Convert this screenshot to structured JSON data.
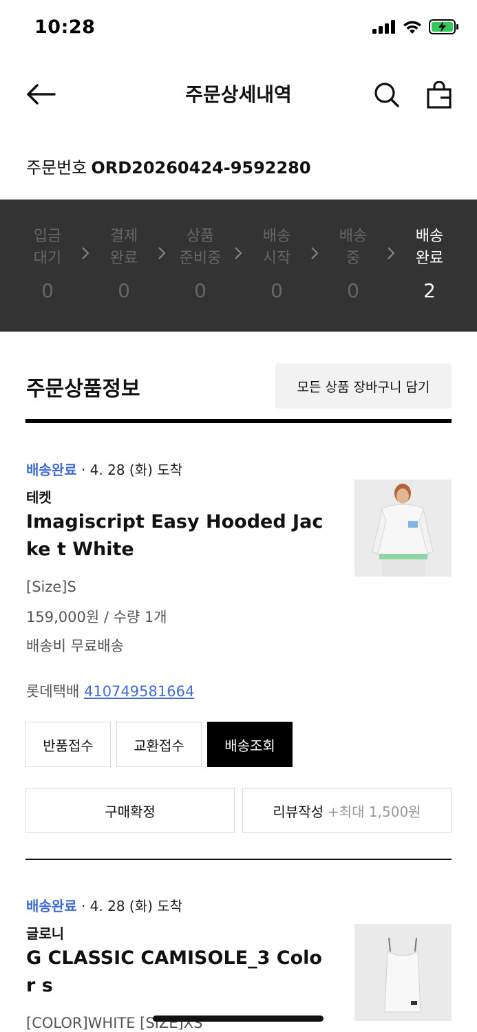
{
  "status_bar": {
    "time": "10:28"
  },
  "header": {
    "title": "주문상세내역"
  },
  "order": {
    "label": "주문번호",
    "number": "ORD20260424-9592280"
  },
  "progress": {
    "steps": [
      {
        "line1": "입금",
        "line2": "대기",
        "count": "0",
        "active": false
      },
      {
        "line1": "결제",
        "line2": "완료",
        "count": "0",
        "active": false
      },
      {
        "line1": "상품",
        "line2": "준비중",
        "count": "0",
        "active": false
      },
      {
        "line1": "배송",
        "line2": "시작",
        "count": "0",
        "active": false
      },
      {
        "line1": "배송",
        "line2": "중",
        "count": "0",
        "active": false
      },
      {
        "line1": "배송",
        "line2": "완료",
        "count": "2",
        "active": true
      }
    ]
  },
  "section": {
    "title": "주문상품정보",
    "add_all_label": "모든 상품 장바구니 담기"
  },
  "items": [
    {
      "delivery_status": "배송완료",
      "delivery_date": "· 4. 28 (화) 도착",
      "brand": "테켓",
      "name": "Imagiscript Easy Hooded Jacke t White",
      "option": "[Size]S",
      "price_qty": "159,000원 / 수량 1개",
      "shipping": "배송비 무료배송",
      "courier": "롯데택배",
      "tracking": "410749581664",
      "buttons": {
        "return": "반품접수",
        "exchange": "교환접수",
        "track": "배송조회",
        "confirm": "구매확정",
        "review": "리뷰작성",
        "review_reward": "+최대 1,500원"
      }
    },
    {
      "delivery_status": "배송완료",
      "delivery_date": "· 4. 28 (화) 도착",
      "brand": "글로니",
      "name": "G CLASSIC CAMISOLE_3 Color s",
      "option": "[COLOR]WHITE [SIZE]XS"
    }
  ],
  "colors": {
    "accent": "#3f6ad8",
    "panel": "#333333",
    "dark_button": "#000000"
  }
}
